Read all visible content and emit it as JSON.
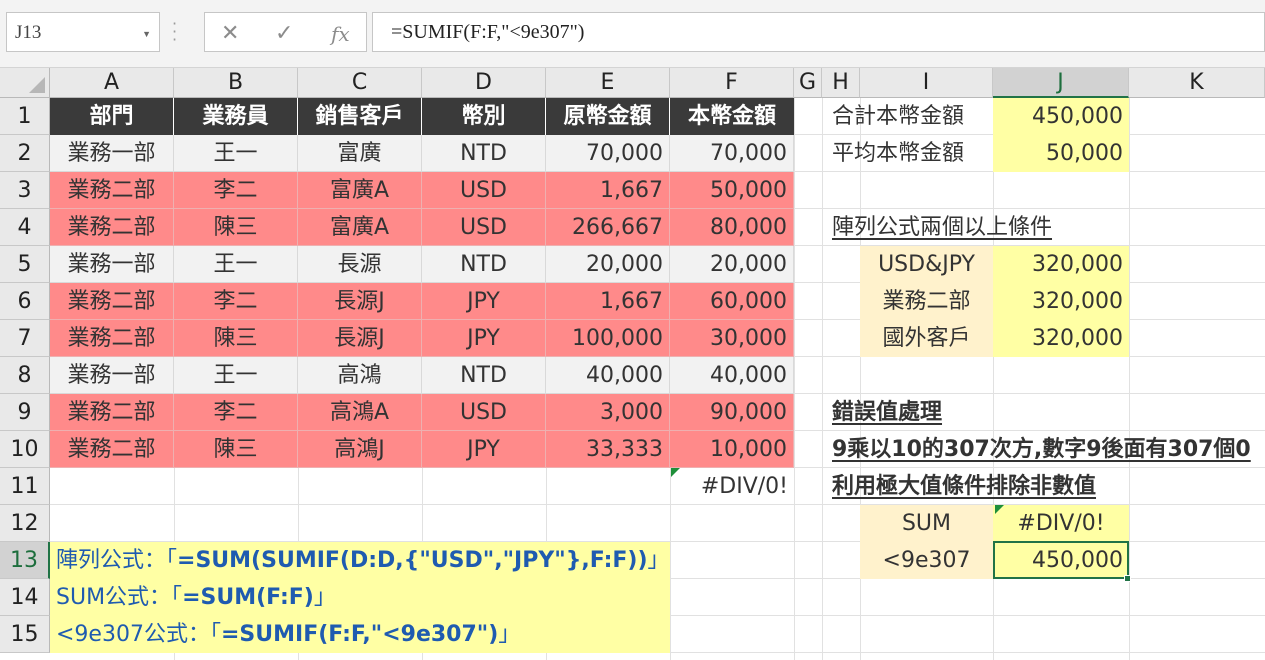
{
  "formula_bar": {
    "name_box": "J13",
    "cancel_icon": "✕",
    "enter_icon": "✓",
    "fx_icon": "fx",
    "formula": "=SUMIF(F:F,\"<9e307\")"
  },
  "columns": [
    "A",
    "B",
    "C",
    "D",
    "E",
    "F",
    "G",
    "H",
    "I",
    "J",
    "K"
  ],
  "rows": [
    "1",
    "2",
    "3",
    "4",
    "5",
    "6",
    "7",
    "8",
    "9",
    "10",
    "11",
    "12",
    "13",
    "14",
    "15"
  ],
  "table": {
    "headers": [
      "部門",
      "業務員",
      "銷售客戶",
      "幣別",
      "原幣金額",
      "本幣金額"
    ],
    "data": [
      [
        "業務一部",
        "王一",
        "富廣",
        "NTD",
        "70,000",
        "70,000"
      ],
      [
        "業務二部",
        "李二",
        "富廣A",
        "USD",
        "1,667",
        "50,000"
      ],
      [
        "業務二部",
        "陳三",
        "富廣A",
        "USD",
        "266,667",
        "80,000"
      ],
      [
        "業務一部",
        "王一",
        "長源",
        "NTD",
        "20,000",
        "20,000"
      ],
      [
        "業務二部",
        "李二",
        "長源J",
        "JPY",
        "1,667",
        "60,000"
      ],
      [
        "業務二部",
        "陳三",
        "長源J",
        "JPY",
        "100,000",
        "30,000"
      ],
      [
        "業務一部",
        "王一",
        "高鴻",
        "NTD",
        "40,000",
        "40,000"
      ],
      [
        "業務二部",
        "李二",
        "高鴻A",
        "USD",
        "3,000",
        "90,000"
      ],
      [
        "業務二部",
        "陳三",
        "高鴻J",
        "JPY",
        "33,333",
        "10,000"
      ]
    ],
    "f11": "#DIV/0!"
  },
  "summary": {
    "total_label": "合計本幣金額",
    "total_value": "450,000",
    "avg_label": "平均本幣金額",
    "avg_value": "50,000"
  },
  "array_section": {
    "title": "陣列公式兩個以上條件",
    "items": [
      {
        "label": "USD&JPY",
        "value": "320,000"
      },
      {
        "label": "業務二部",
        "value": "320,000"
      },
      {
        "label": "國外客戶",
        "value": "320,000"
      }
    ]
  },
  "error_section": {
    "title": "錯誤值處理",
    "line1": "9乘以10的307次方,數字9後面有307個0",
    "line2": "利用極大值條件排除非數值",
    "sum_label": "SUM",
    "sum_value": "#DIV/0!",
    "lt_label": "<9e307",
    "lt_value": "450,000"
  },
  "notes": {
    "n13_prefix": "陣列公式：「",
    "n13_formula": "=SUM(SUMIF(D:D,{\"USD\",\"JPY\"},F:F))",
    "n13_suffix": "」",
    "n14_prefix": "SUM公式：「",
    "n14_formula": "=SUM(F:F)",
    "n14_suffix": "」",
    "n15_prefix": "<9e307公式：「",
    "n15_formula": "=SUMIF(F:F,\"<9e307\")",
    "n15_suffix": "」"
  },
  "colors": {
    "header_dark": "#3a3a3a",
    "row_red": "#ff8a8a",
    "row_gray": "#f2f2f2",
    "yellow": "#ffffa4",
    "peach": "#fff2cc",
    "excel_green": "#217346"
  }
}
